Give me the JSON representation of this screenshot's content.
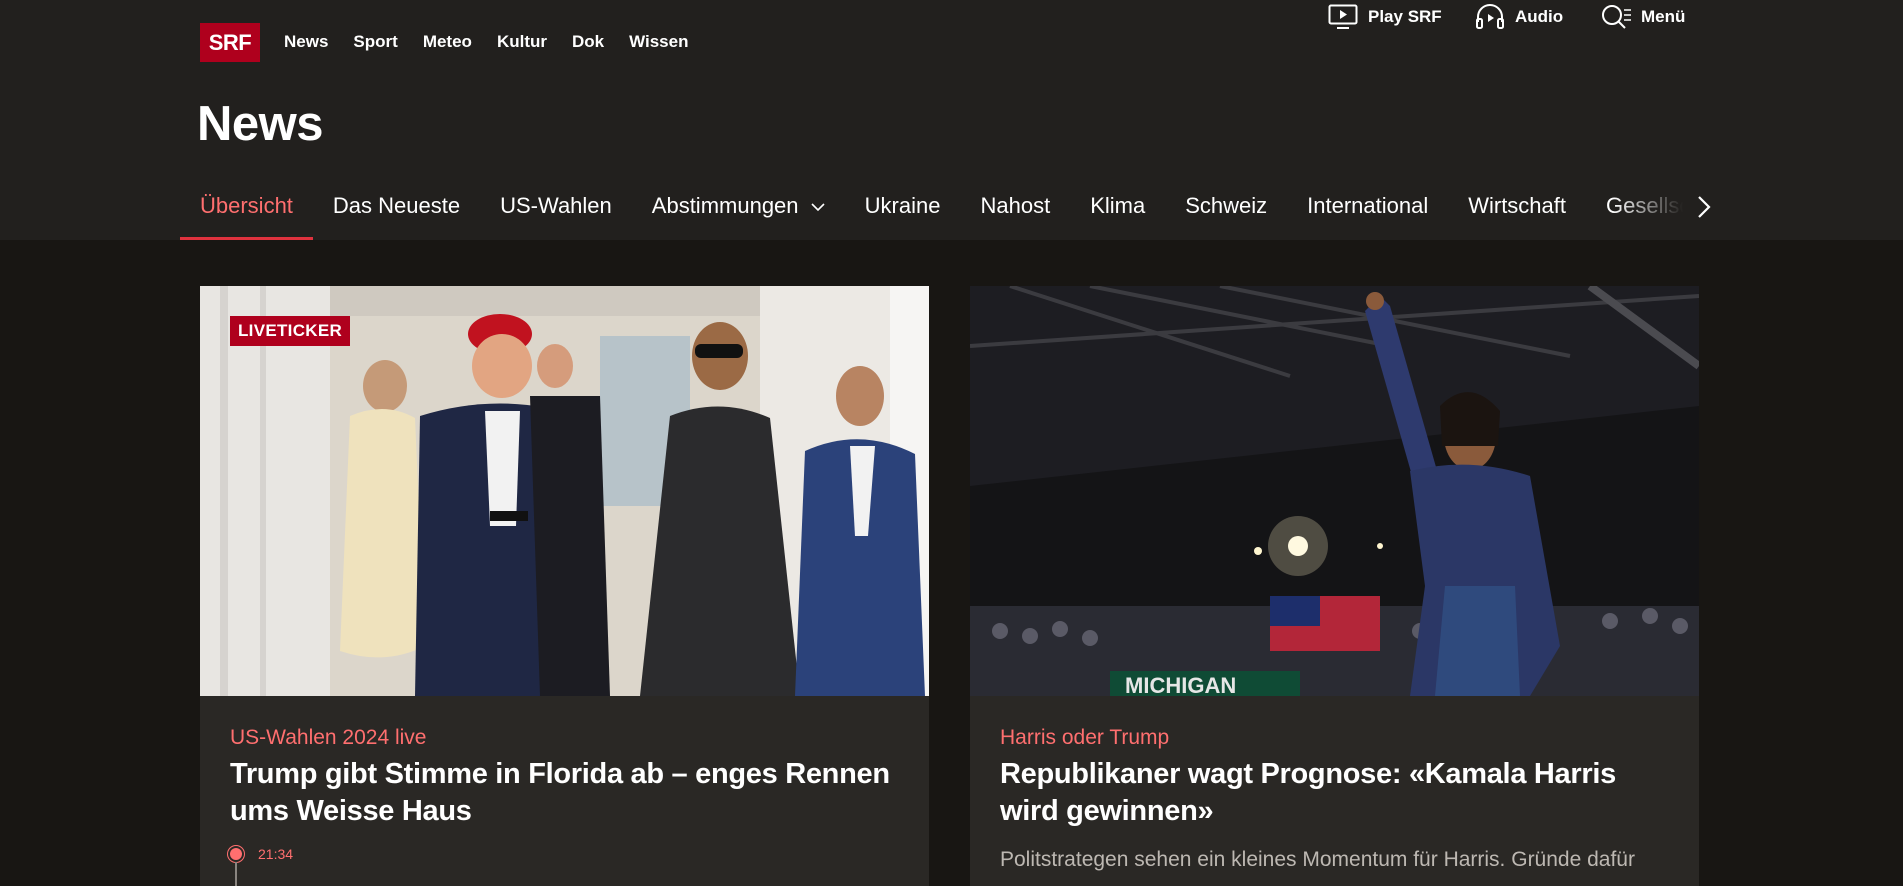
{
  "brand": {
    "logo_text": "SRF",
    "logo_color": "#af001d",
    "accent_color": "#ff6f6f"
  },
  "topnav": [
    "News",
    "Sport",
    "Meteo",
    "Kultur",
    "Dok",
    "Wissen"
  ],
  "rightnav": {
    "play_label": "Play SRF",
    "audio_label": "Audio",
    "menu_label": "Menü"
  },
  "page_title": "News",
  "subnav": {
    "tabs": [
      "Übersicht",
      "Das Neueste",
      "US-Wahlen",
      "Abstimmungen",
      "Ukraine",
      "Nahost",
      "Klima",
      "Schweiz",
      "International",
      "Wirtschaft",
      "Gesellschaft"
    ],
    "active": "Übersicht"
  },
  "cards": [
    {
      "badge": "LIVETICKER",
      "kicker": "US-Wahlen 2024 live",
      "headline": "Trump gibt Stimme in Florida ab – enges Rennen ums Weisse Haus",
      "ticker_time": "21:34"
    },
    {
      "kicker": "Harris oder Trump",
      "headline": "Republikaner wagt Prognose: «Kamala Harris wird gewinnen»",
      "lead": "Politstrategen sehen ein kleines Momentum für Harris. Gründe dafür"
    }
  ]
}
